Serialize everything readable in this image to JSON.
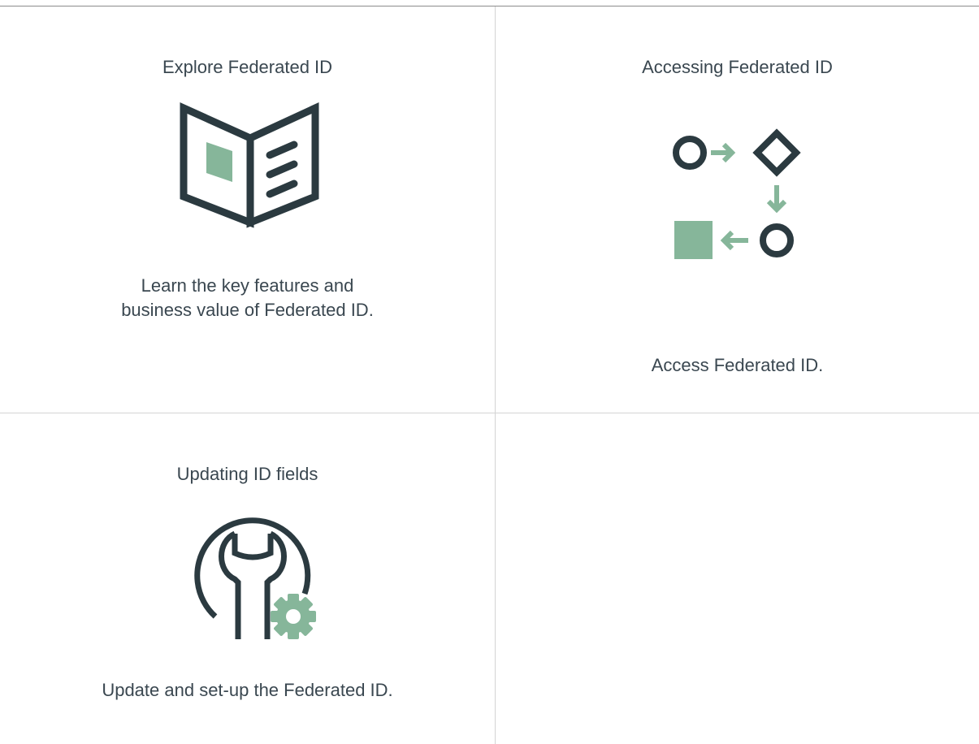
{
  "cards": [
    {
      "title": "Explore Federated ID",
      "icon": "open-book-icon",
      "description_lines": [
        "Learn the key features and",
        "business value of Federated ID."
      ]
    },
    {
      "title": "Accessing Federated ID",
      "icon": "workflow-icon",
      "description_lines": [
        "Access Federated ID."
      ]
    },
    {
      "title": "Updating ID fields",
      "icon": "wrench-gear-icon",
      "description_lines": [
        "Update and set-up the Federated ID."
      ]
    }
  ],
  "colors": {
    "icon_dark": "#2b3a40",
    "icon_accent": "#86b69a",
    "text": "#3a4750",
    "divider": "#d4d4d4"
  }
}
